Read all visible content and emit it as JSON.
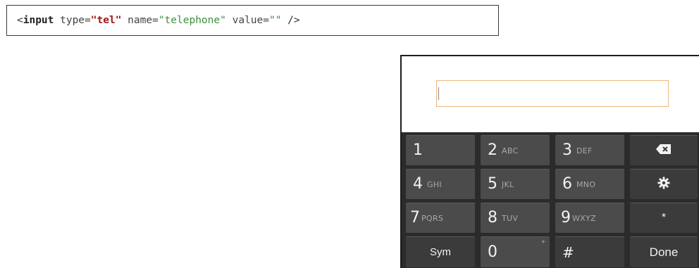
{
  "code": {
    "open": "<",
    "tag": "input",
    "attr_type": " type=",
    "type_value": "\"tel\"",
    "attr_name": " name=",
    "name_value": "\"telephone\"",
    "attr_value": " value=",
    "value_value": "\"\"",
    "close": " />"
  },
  "field": {
    "value": ""
  },
  "keypad": {
    "row1": [
      {
        "digit": "1",
        "letters": ""
      },
      {
        "digit": "2",
        "letters": "ABC"
      },
      {
        "digit": "3",
        "letters": "DEF"
      }
    ],
    "row2": [
      {
        "digit": "4",
        "letters": "GHI"
      },
      {
        "digit": "5",
        "letters": "JKL"
      },
      {
        "digit": "6",
        "letters": "MNO"
      }
    ],
    "row3": [
      {
        "digit": "7",
        "letters": "PQRS"
      },
      {
        "digit": "8",
        "letters": "TUV"
      },
      {
        "digit": "9",
        "letters": "WXYZ"
      }
    ],
    "sym_label": "Sym",
    "zero_digit": "0",
    "zero_secondary": "+",
    "hash_label": "#",
    "star_label": "*",
    "done_label": "Done",
    "backspace_icon": "backspace-icon",
    "settings_icon": "gear-icon"
  },
  "colors": {
    "input_border": "#efb57a",
    "keyboard_bg": "#2b2b2b",
    "key_bg": "#4b4b4b",
    "type_value": "#a01818",
    "string_value": "#3e8f3e"
  }
}
